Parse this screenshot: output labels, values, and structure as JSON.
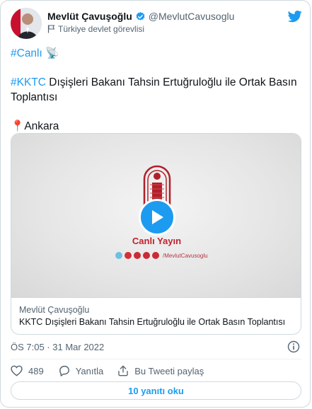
{
  "user": {
    "name": "Mevlüt Çavuşoğlu",
    "handle": "@MevlutCavusoglu",
    "label": "Türkiye devlet görevlisi"
  },
  "tweet": {
    "hashtag_live": "#Canlı",
    "live_emoji": "📡",
    "hashtag_kktc": "#KKTC",
    "headline_rest": " Dışişleri Bakanı Tahsin Ertuğruloğlu ile Ortak Basın Toplantısı",
    "pin_emoji": "📍",
    "location": "Ankara"
  },
  "media": {
    "overlay_title": "Canlı Yayın",
    "overlay_handle": "/MevlutCavusoglu",
    "author": "Mevlüt Çavuşoğlu",
    "title": "KKTC Dışişleri Bakanı Tahsin Ertuğruloğlu ile Ortak Basın Toplantısı"
  },
  "meta": {
    "timestamp": "ÖS 7:05 · 31 Mar 2022"
  },
  "actions": {
    "likes": "489",
    "reply_label": "Yanıtla",
    "share_label": "Bu Tweeti paylaş"
  },
  "footer": {
    "replies_button": "10 yanıtı oku"
  },
  "colors": {
    "brand_blue": "#1d9bf0",
    "overlay_red": "#c0222f",
    "secondary_text": "#536471",
    "border": "#cfd9de"
  },
  "icons": [
    "verified-badge-icon",
    "flag-icon",
    "twitter-bird-icon",
    "play-icon",
    "info-icon",
    "heart-icon",
    "reply-icon",
    "share-icon"
  ]
}
